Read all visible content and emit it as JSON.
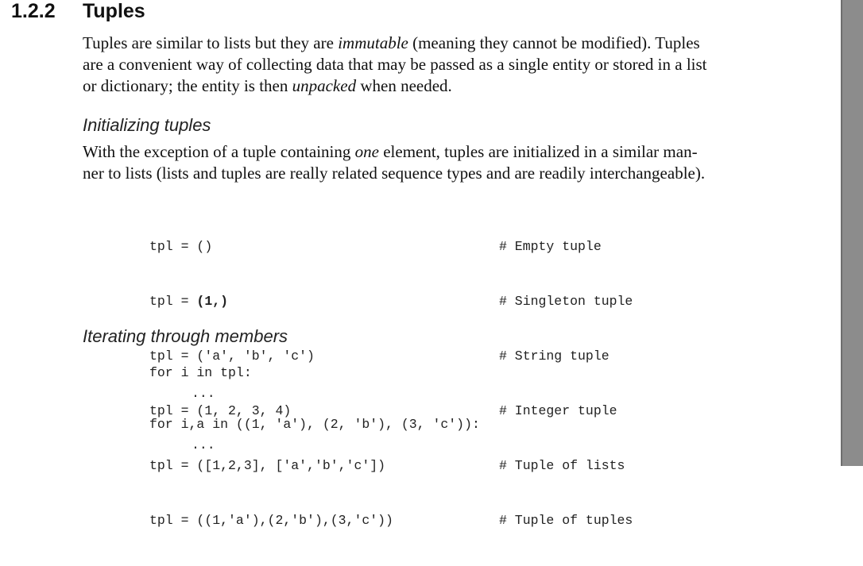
{
  "section": {
    "number": "1.2.2",
    "title": "Tuples"
  },
  "intro": {
    "lines": [
      [
        "Tuples are similar to lists but they are ",
        "immutable",
        " (meaning they cannot be modified). Tuples"
      ],
      [
        "are a convenient way of collecting data that may be passed as a single entity or stored in a list"
      ],
      [
        "or dictionary; the entity is then ",
        "unpacked",
        " when needed."
      ]
    ]
  },
  "init": {
    "title": "Initializing tuples",
    "line1_a": "With the exception of a tuple containing ",
    "line1_em": "one",
    "line1_b": " element, tuples are initialized in a similar man-",
    "line2": "ner to lists (lists and tuples are really related sequence types and are readily interchangeable).",
    "code_prefix": "tpl = ",
    "code": [
      "()",
      "(1,)",
      "('a', 'b', 'c')",
      "(1, 2, 3, 4)",
      "([1,2,3], ['a','b','c'])",
      "((1,'a'),(2,'b'),(3,'c'))"
    ],
    "comments": [
      "# Empty tuple",
      "# Singleton tuple",
      "# String tuple",
      "# Integer tuple",
      "# Tuple of lists",
      "# Tuple of tuples"
    ]
  },
  "iter": {
    "title": "Iterating through members",
    "loop1": "for i in tpl:",
    "body1": "...",
    "loop2": "for i,a in ((1, 'a'), (2, 'b'), (3, 'c')):",
    "body2": "..."
  }
}
